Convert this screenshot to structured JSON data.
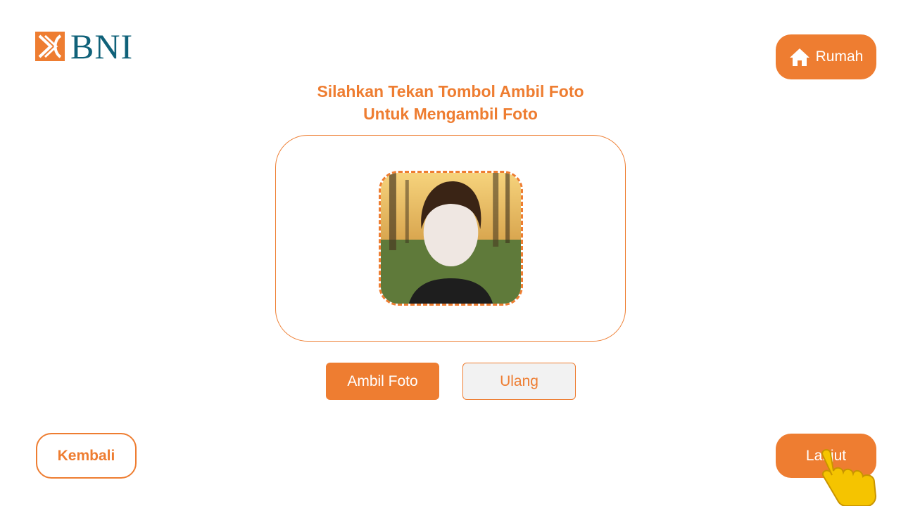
{
  "brand": {
    "name": "BNI",
    "icon": "bni-logo-icon",
    "colors": {
      "primary_orange": "#ee7d31",
      "brand_teal": "#0f6179"
    }
  },
  "header": {
    "home_button": {
      "label": "Rumah",
      "icon": "home-icon"
    }
  },
  "instruction": {
    "line1": "Silahkan Tekan Tombol Ambil Foto",
    "line2": "Untuk Mengambil Foto"
  },
  "camera": {
    "preview_icon": "face-photo-preview"
  },
  "actions": {
    "capture_label": "Ambil Foto",
    "retake_label": "Ulang"
  },
  "footer": {
    "back_label": "Kembali",
    "next_label": "Lanjut",
    "pointer_icon": "hand-pointer-icon"
  }
}
